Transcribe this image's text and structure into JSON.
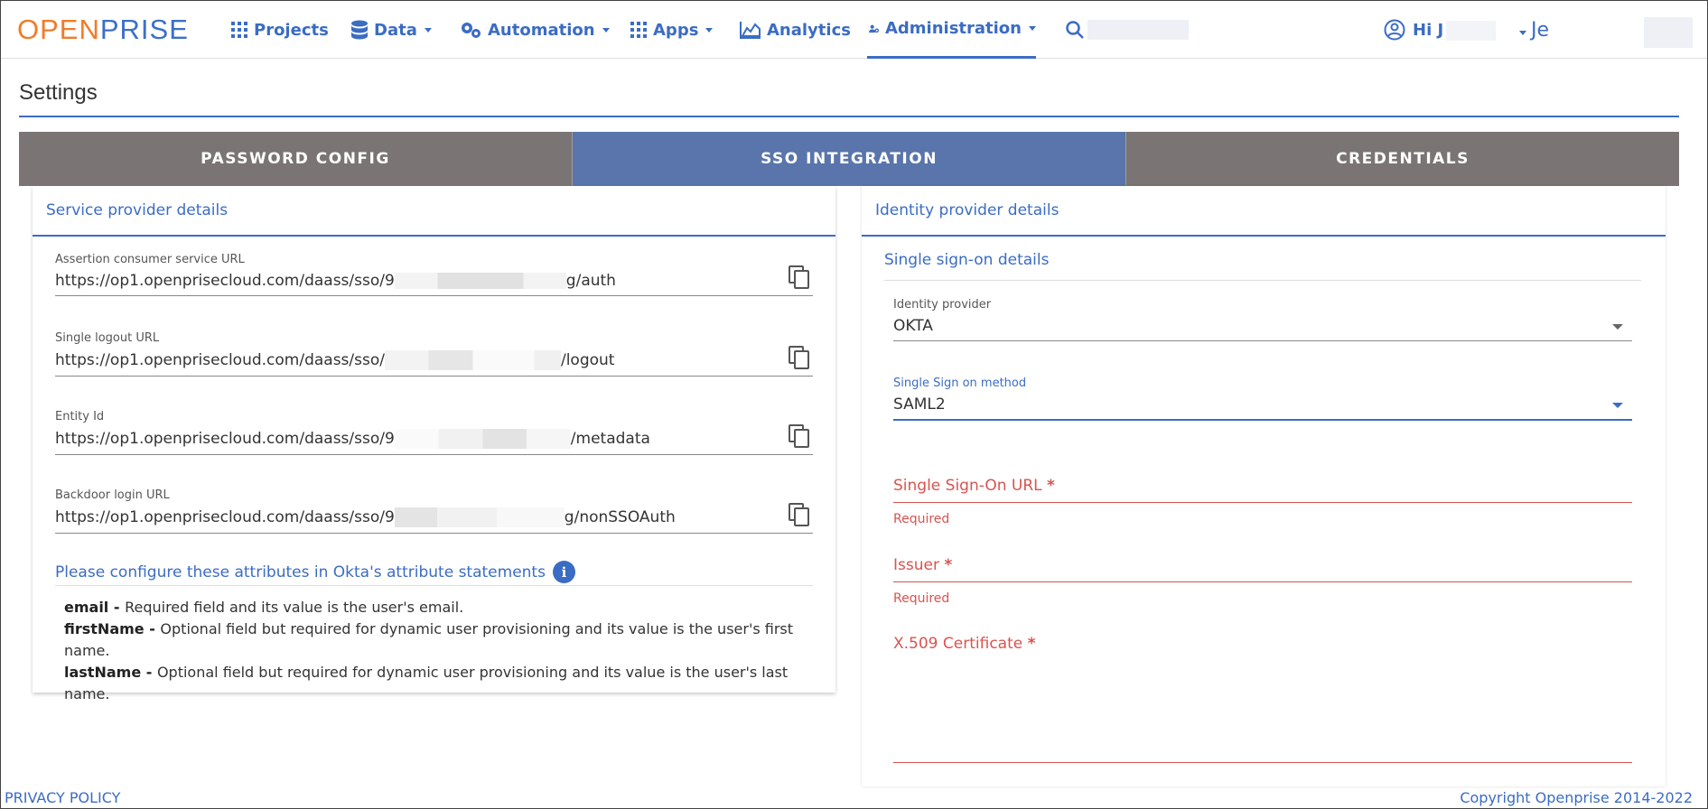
{
  "nav": {
    "logo_part1": "OPEN",
    "logo_part2": "PRISE",
    "items": [
      {
        "label": "Projects"
      },
      {
        "label": "Data"
      },
      {
        "label": "Automation"
      },
      {
        "label": "Apps"
      },
      {
        "label": "Analytics"
      },
      {
        "label": "Administration"
      }
    ],
    "greeting": "Hi J",
    "user_initial": "Je"
  },
  "page": {
    "title": "Settings"
  },
  "tabs": [
    {
      "label": "PASSWORD CONFIG"
    },
    {
      "label": "SSO INTEGRATION"
    },
    {
      "label": "CREDENTIALS"
    }
  ],
  "service_provider": {
    "heading": "Service provider details",
    "fields": [
      {
        "label": "Assertion consumer service URL",
        "value_prefix": "https://op1.openprisecloud.com/daass/sso/9",
        "value_suffix": "g/auth"
      },
      {
        "label": "Single logout URL",
        "value_prefix": "https://op1.openprisecloud.com/daass/sso/",
        "value_suffix": "/logout"
      },
      {
        "label": "Entity Id",
        "value_prefix": "https://op1.openprisecloud.com/daass/sso/9",
        "value_suffix": "/metadata"
      },
      {
        "label": "Backdoor login URL",
        "value_prefix": "https://op1.openprisecloud.com/daass/sso/9",
        "value_suffix": "g/nonSSOAuth"
      }
    ],
    "okta_title": "Please configure these attributes in Okta's attribute statements",
    "attributes": [
      {
        "name": "email - ",
        "desc": "Required field and its value is the user's email."
      },
      {
        "name": "firstName - ",
        "desc": "Optional field but required for dynamic user provisioning and its value is the user's first name."
      },
      {
        "name": "lastName - ",
        "desc": "Optional field but required for dynamic user provisioning and its value is the user's last name."
      }
    ]
  },
  "identity_provider": {
    "heading": "Identity provider details",
    "sub_heading": "Single sign-on details",
    "idp_label": "Identity provider",
    "idp_value": "OKTA",
    "method_label": "Single Sign on method",
    "method_value": "SAML2",
    "sso_url_label": "Single Sign-On URL",
    "issuer_label": "Issuer",
    "cert_label": "X.509 Certificate",
    "required_text": "Required",
    "star": "*"
  },
  "footer": {
    "privacy": "PRIVACY POLICY",
    "copyright": "Copyright Openprise 2014-2022"
  },
  "colors": {
    "accent": "#3b6cc4",
    "logo_orange": "#f07c2a",
    "tab_active": "#5a75ab",
    "tab_inactive": "#7a7574",
    "error": "#d9534f"
  }
}
